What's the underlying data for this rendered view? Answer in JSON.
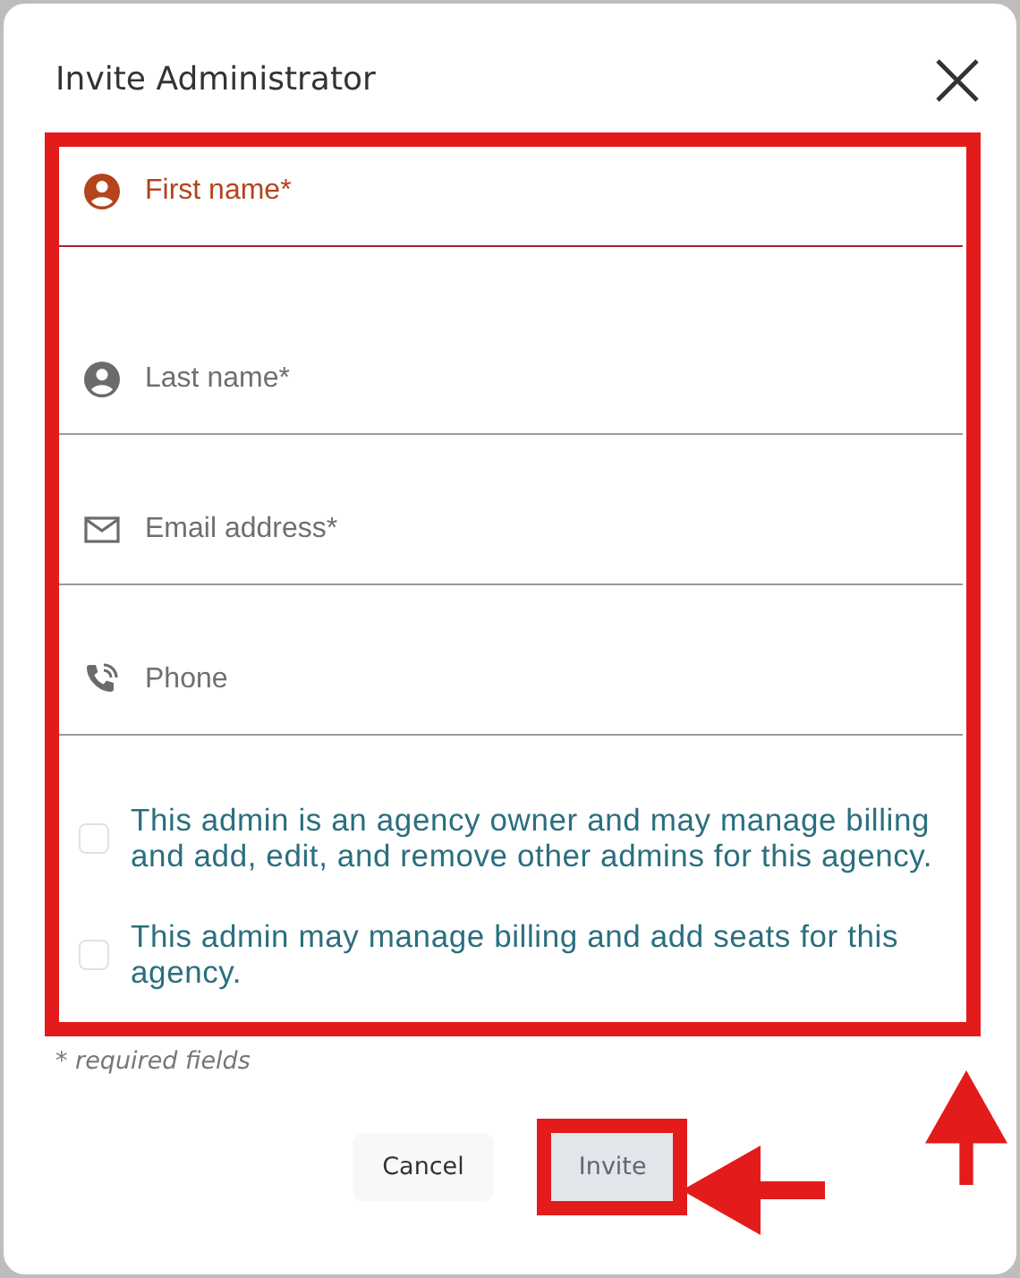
{
  "dialog": {
    "title": "Invite Administrator"
  },
  "form": {
    "highlighted": true,
    "fields": [
      {
        "placeholder": "First name*",
        "kind": "person",
        "focused": true
      },
      {
        "placeholder": "Last name*",
        "kind": "person",
        "focused": false
      },
      {
        "placeholder": "Email address*",
        "kind": "email",
        "focused": false
      },
      {
        "placeholder": "Phone",
        "kind": "phone",
        "focused": false
      }
    ],
    "options": [
      {
        "label": "This admin is an agency owner and may manage billing and add, edit, and remove other admins for this agency.",
        "checked": false
      },
      {
        "label": "This admin may manage billing and add seats for this agency.",
        "checked": false
      }
    ]
  },
  "required_note": "* required fields",
  "buttons": [
    {
      "label": "Cancel",
      "kind": "secondary",
      "disabled": false,
      "highlighted": false
    },
    {
      "label": "Invite",
      "kind": "primary",
      "disabled": true,
      "highlighted": true
    }
  ]
}
